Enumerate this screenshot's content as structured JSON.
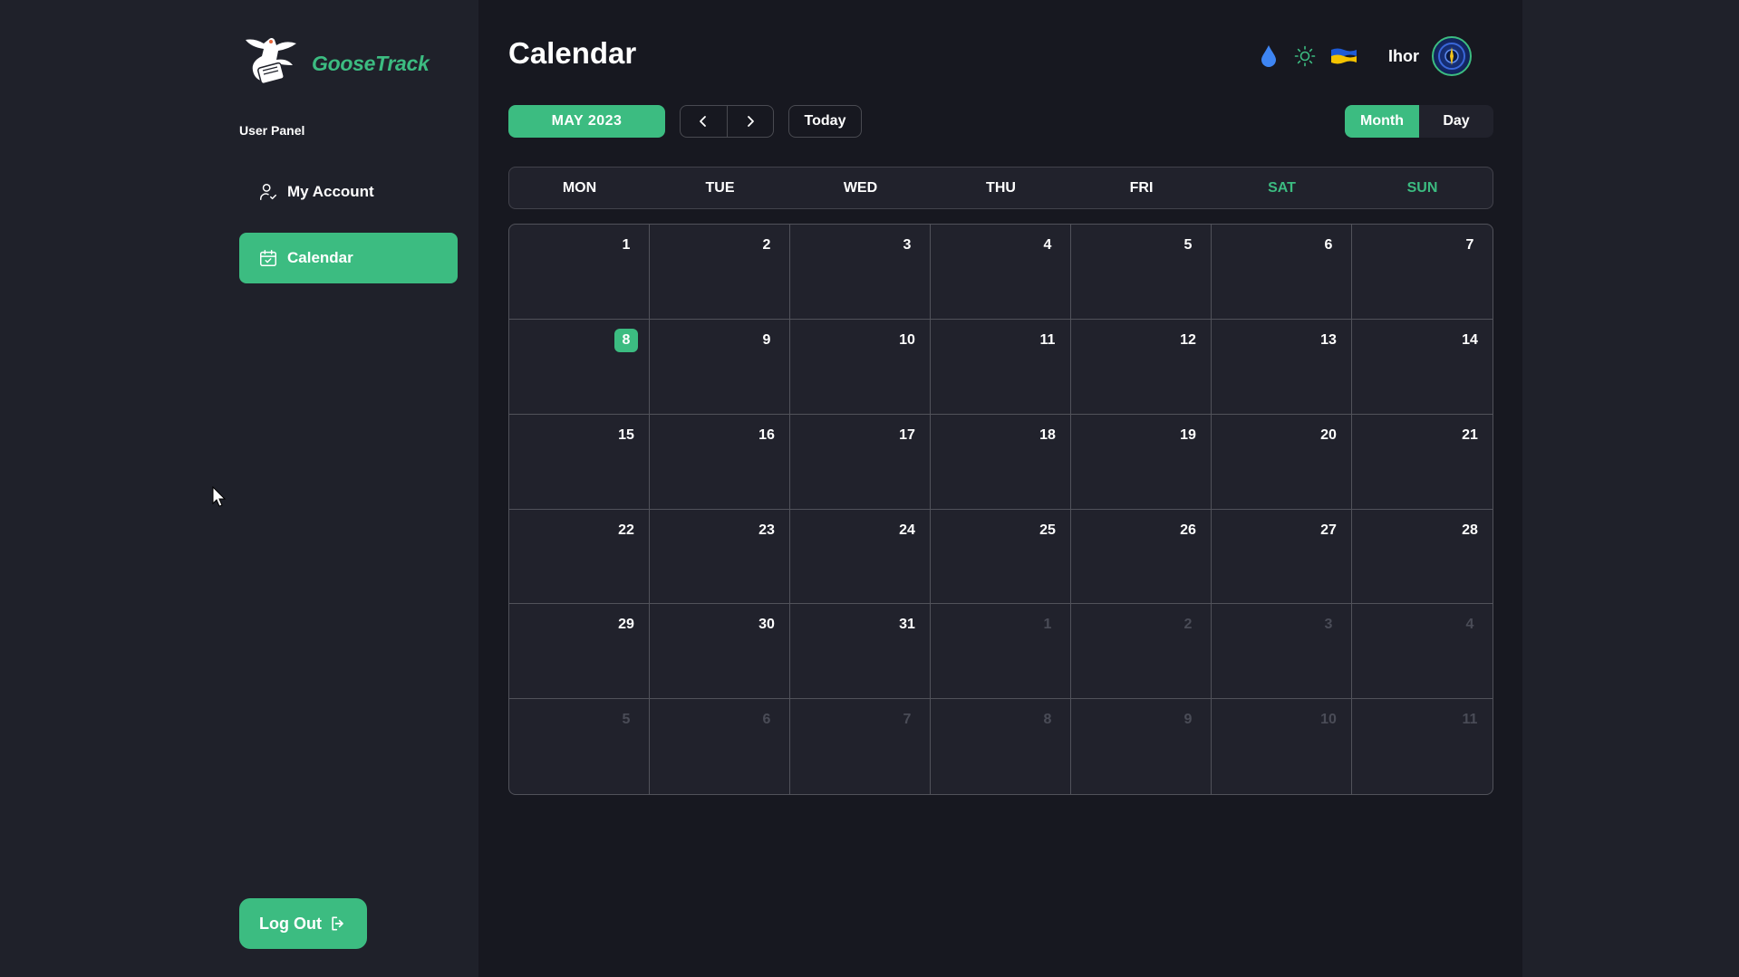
{
  "brand": {
    "name": "GooseTrack"
  },
  "sidebar": {
    "panel_label": "User Panel",
    "items": [
      {
        "label": "My Account",
        "icon": "user-check-icon",
        "active": false
      },
      {
        "label": "Calendar",
        "icon": "calendar-check-icon",
        "active": true
      }
    ],
    "logout_label": "Log Out"
  },
  "header": {
    "title": "Calendar",
    "user_name": "Ihor",
    "icons": [
      "water-drop-icon",
      "sun-icon",
      "ukraine-flag-icon"
    ]
  },
  "toolbar": {
    "month_label": "MAY 2023",
    "prev_icon": "chevron-left-icon",
    "next_icon": "chevron-right-icon",
    "today_label": "Today",
    "views": [
      {
        "label": "Month",
        "active": true
      },
      {
        "label": "Day",
        "active": false
      }
    ]
  },
  "calendar": {
    "weekdays": [
      "MON",
      "TUE",
      "WED",
      "THU",
      "FRI",
      "SAT",
      "SUN"
    ],
    "weekend": [
      "SAT",
      "SUN"
    ],
    "today": 8,
    "days": [
      {
        "n": "1",
        "m": "cur"
      },
      {
        "n": "2",
        "m": "cur"
      },
      {
        "n": "3",
        "m": "cur"
      },
      {
        "n": "4",
        "m": "cur"
      },
      {
        "n": "5",
        "m": "cur"
      },
      {
        "n": "6",
        "m": "cur"
      },
      {
        "n": "7",
        "m": "cur"
      },
      {
        "n": "8",
        "m": "cur",
        "today": true
      },
      {
        "n": "9",
        "m": "cur"
      },
      {
        "n": "10",
        "m": "cur"
      },
      {
        "n": "11",
        "m": "cur"
      },
      {
        "n": "12",
        "m": "cur"
      },
      {
        "n": "13",
        "m": "cur"
      },
      {
        "n": "14",
        "m": "cur"
      },
      {
        "n": "15",
        "m": "cur"
      },
      {
        "n": "16",
        "m": "cur"
      },
      {
        "n": "17",
        "m": "cur"
      },
      {
        "n": "18",
        "m": "cur"
      },
      {
        "n": "19",
        "m": "cur"
      },
      {
        "n": "20",
        "m": "cur"
      },
      {
        "n": "21",
        "m": "cur"
      },
      {
        "n": "22",
        "m": "cur"
      },
      {
        "n": "23",
        "m": "cur"
      },
      {
        "n": "24",
        "m": "cur"
      },
      {
        "n": "25",
        "m": "cur"
      },
      {
        "n": "26",
        "m": "cur"
      },
      {
        "n": "27",
        "m": "cur"
      },
      {
        "n": "28",
        "m": "cur"
      },
      {
        "n": "29",
        "m": "cur"
      },
      {
        "n": "30",
        "m": "cur"
      },
      {
        "n": "31",
        "m": "cur"
      },
      {
        "n": "1",
        "m": "next"
      },
      {
        "n": "2",
        "m": "next"
      },
      {
        "n": "3",
        "m": "next"
      },
      {
        "n": "4",
        "m": "next"
      },
      {
        "n": "5",
        "m": "next"
      },
      {
        "n": "6",
        "m": "next"
      },
      {
        "n": "7",
        "m": "next"
      },
      {
        "n": "8",
        "m": "next"
      },
      {
        "n": "9",
        "m": "next"
      },
      {
        "n": "10",
        "m": "next"
      },
      {
        "n": "11",
        "m": "next"
      }
    ]
  },
  "colors": {
    "accent": "#3cbc81",
    "background": "#171820",
    "panel": "#1f212a",
    "other_month_text": "#4a4c57"
  }
}
